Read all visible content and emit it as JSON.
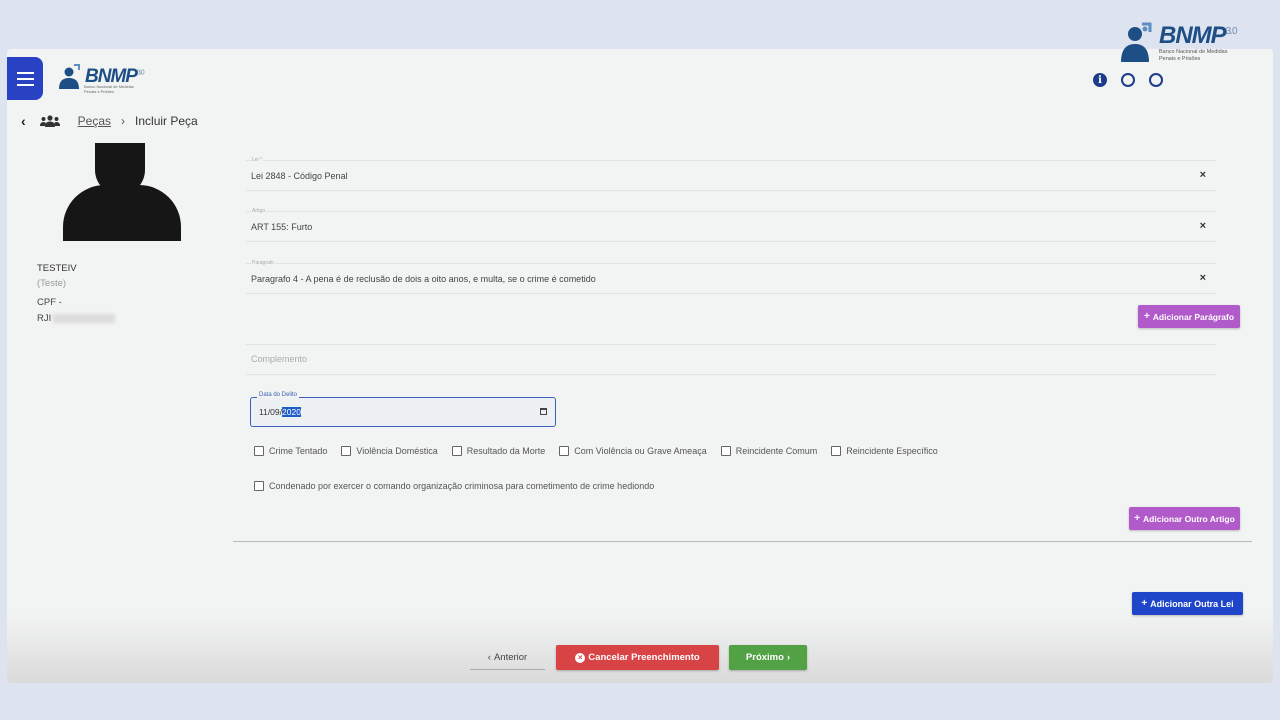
{
  "corner_logo": {
    "title": "BNMP",
    "version": "3.0",
    "subtitle": "Banco Nacional de Medidas Penais e Prisões"
  },
  "header": {
    "logo_title": "BNMP",
    "logo_version": "3.0",
    "logo_subtitle": "Banco Nacional de Medidas Penais e Prisões",
    "icons": [
      "info-icon",
      "globe-icon",
      "search-icon"
    ],
    "info_glyph": "i"
  },
  "breadcrumb": {
    "back_glyph": "‹",
    "link": "Peças",
    "separator": "›",
    "current": "Incluir Peça"
  },
  "person": {
    "name": "TESTEIV",
    "alias": "(Teste)",
    "cpf_label": "CPF -",
    "rji_label": "RJI"
  },
  "form": {
    "lei": {
      "label": "Lei *",
      "value": "Lei 2848 - Código Penal",
      "clear": "×"
    },
    "artigo": {
      "label": "Artigo",
      "value": "ART 155: Furto",
      "clear": "×"
    },
    "paragrafo": {
      "label": "Paragrafo",
      "value": "Paragrafo 4 - A pena é de reclusão de dois a oito anos, e multa, se o crime é cometido",
      "clear": "×"
    },
    "add_paragrafo": "Adicionar Parágrafo",
    "complemento_placeholder": "Complemento",
    "data_delito": {
      "label": "Data do Delito",
      "day_month": "11/09/",
      "year": "2020"
    },
    "checkboxes": [
      "Crime Tentado",
      "Violência Doméstica",
      "Resultado da Morte",
      "Com Violência ou Grave Ameaça",
      "Reincidente Comum",
      "Reincidente Específico"
    ],
    "checkbox_long": "Condenado por exercer o comando organização criminosa para cometimento de crime hediondo",
    "add_artigo": "Adicionar Outro Artigo",
    "add_lei": "Adicionar Outra Lei"
  },
  "footer": {
    "anterior": "Anterior",
    "cancelar": "Cancelar Preenchimento",
    "proximo": "Próximo",
    "plus_glyph": "+",
    "cancel_glyph": "×",
    "prev_glyph": "‹",
    "next_glyph": "›"
  },
  "colors": {
    "primary_blue": "#1f45c8",
    "purple": "#b15bca",
    "red": "#d84446",
    "green": "#52a145"
  }
}
